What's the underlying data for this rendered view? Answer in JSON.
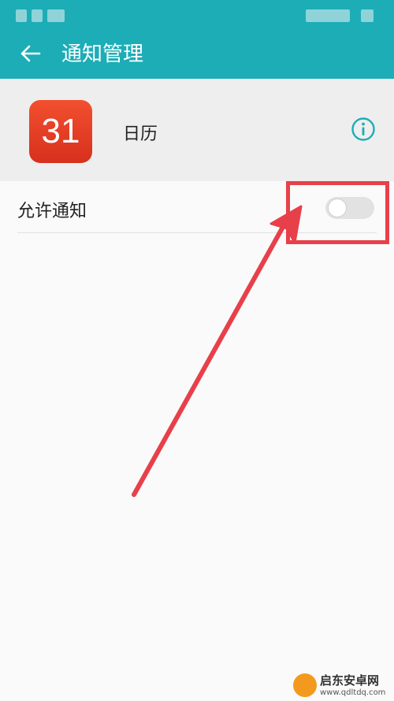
{
  "header": {
    "title": "通知管理",
    "back_icon": "arrow-left-icon"
  },
  "app": {
    "icon_text": "31",
    "name": "日历",
    "info_icon": "info-icon"
  },
  "settings": [
    {
      "label": "允许通知",
      "toggle_on": false
    }
  ],
  "annotation": {
    "highlight_color": "#e8404a"
  },
  "watermark": {
    "main": "启东安卓网",
    "url": "www.qdltdq.com"
  },
  "colors": {
    "accent": "#1cadb7",
    "app_icon": "#e03a22"
  }
}
